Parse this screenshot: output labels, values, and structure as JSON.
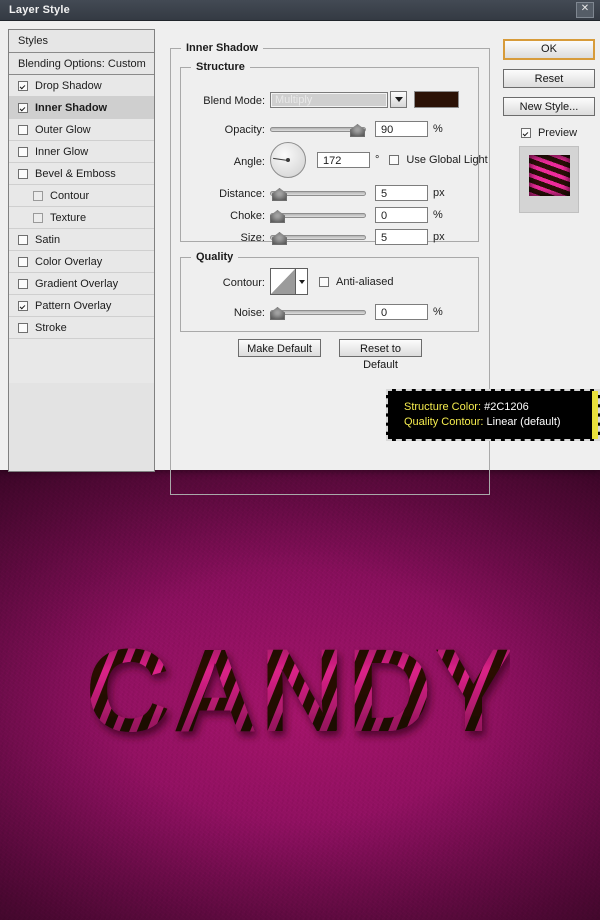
{
  "window": {
    "title": "Layer Style",
    "close_label": "✕"
  },
  "styles_panel": {
    "header": "Styles",
    "blending_options": "Blending Options: Custom",
    "items": [
      {
        "label": "Drop Shadow",
        "checked": true,
        "sub": false,
        "selected": false
      },
      {
        "label": "Inner Shadow",
        "checked": true,
        "sub": false,
        "selected": true
      },
      {
        "label": "Outer Glow",
        "checked": false,
        "sub": false,
        "selected": false
      },
      {
        "label": "Inner Glow",
        "checked": false,
        "sub": false,
        "selected": false
      },
      {
        "label": "Bevel & Emboss",
        "checked": false,
        "sub": false,
        "selected": false
      },
      {
        "label": "Contour",
        "checked": false,
        "sub": true,
        "selected": false
      },
      {
        "label": "Texture",
        "checked": false,
        "sub": true,
        "selected": false
      },
      {
        "label": "Satin",
        "checked": false,
        "sub": false,
        "selected": false
      },
      {
        "label": "Color Overlay",
        "checked": false,
        "sub": false,
        "selected": false
      },
      {
        "label": "Gradient Overlay",
        "checked": false,
        "sub": false,
        "selected": false
      },
      {
        "label": "Pattern Overlay",
        "checked": true,
        "sub": false,
        "selected": false
      },
      {
        "label": "Stroke",
        "checked": false,
        "sub": false,
        "selected": false
      }
    ]
  },
  "effect_panel": {
    "title": "Inner Shadow",
    "structure": {
      "title": "Structure",
      "blend_mode_label": "Blend Mode:",
      "blend_mode_value": "Multiply",
      "color_swatch": "#2C1206",
      "opacity_label": "Opacity:",
      "opacity_value": "90",
      "opacity_unit": "%",
      "angle_label": "Angle:",
      "angle_value": "172",
      "angle_unit": "°",
      "use_global_light": "Use Global Light",
      "use_global_light_checked": false,
      "distance_label": "Distance:",
      "distance_value": "5",
      "distance_unit": "px",
      "choke_label": "Choke:",
      "choke_value": "0",
      "choke_unit": "%",
      "size_label": "Size:",
      "size_value": "5",
      "size_unit": "px"
    },
    "quality": {
      "title": "Quality",
      "contour_label": "Contour:",
      "contour_preset": "Linear",
      "anti_aliased": "Anti-aliased",
      "anti_aliased_checked": false,
      "noise_label": "Noise:",
      "noise_value": "0",
      "noise_unit": "%"
    },
    "make_default": "Make Default",
    "reset_to_default": "Reset to Default"
  },
  "actions": {
    "ok": "OK",
    "reset": "Reset",
    "new_style": "New Style...",
    "preview": "Preview",
    "preview_checked": true
  },
  "tooltip": {
    "line1_key": "Structure Color:",
    "line1_value": "#2C1206",
    "line2_key": "Quality Contour:",
    "line2_value": "Linear (default)"
  },
  "artwork": {
    "text": "CANDY",
    "stripe_pink": "#e6238f",
    "stripe_dark": "#2c1206",
    "background": "#8d1060"
  }
}
